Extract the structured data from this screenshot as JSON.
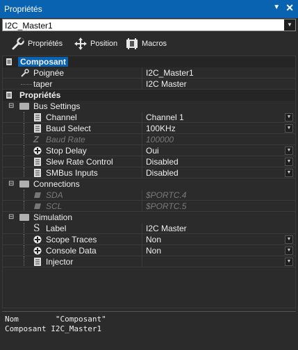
{
  "window": {
    "title": "Propriétés"
  },
  "object_selector": {
    "value": "I2C_Master1"
  },
  "toolbar": [
    {
      "label": "Propriétés",
      "icon": "wrench-icon"
    },
    {
      "label": "Position",
      "icon": "move-arrows-icon"
    },
    {
      "label": "Macros",
      "icon": "macros-icon"
    }
  ],
  "sections": {
    "composant": {
      "label": "Composant",
      "handle": {
        "name": "Poignée",
        "value": "I2C_Master1"
      },
      "type": {
        "name": "taper",
        "value": "I2C Master"
      }
    },
    "proprietes": {
      "label": "Propriétés"
    },
    "bus_settings": {
      "label": "Bus Settings",
      "channel": {
        "name": "Channel",
        "value": "Channel 1"
      },
      "baud_select": {
        "name": "Baud Select",
        "value": "100KHz"
      },
      "baud_rate": {
        "name": "Baud Rate",
        "value": "100000"
      },
      "stop_delay": {
        "name": "Stop Delay",
        "value": "Oui"
      },
      "slew_rate": {
        "name": "Slew Rate Control",
        "value": "Disabled"
      },
      "smbus": {
        "name": "SMBus Inputs",
        "value": "Disabled"
      }
    },
    "connections": {
      "label": "Connections",
      "sda": {
        "name": "SDA",
        "value": "$PORTC.4"
      },
      "scl": {
        "name": "SCL",
        "value": "$PORTC.5"
      }
    },
    "simulation": {
      "label": "Simulation",
      "label_prop": {
        "name": "Label",
        "value": "I2C Master"
      },
      "scope_traces": {
        "name": "Scope Traces",
        "value": "Non"
      },
      "console_data": {
        "name": "Console Data",
        "value": "Non"
      },
      "injector": {
        "name": "Injector",
        "value": ""
      }
    }
  },
  "description": {
    "line1_key": "Nom",
    "line1_val": "\"Composant\"",
    "line2_key": "Composant",
    "line2_val": "I2C_Master1"
  },
  "colors": {
    "accent": "#0a63b0",
    "background": "#2b2b2b"
  }
}
